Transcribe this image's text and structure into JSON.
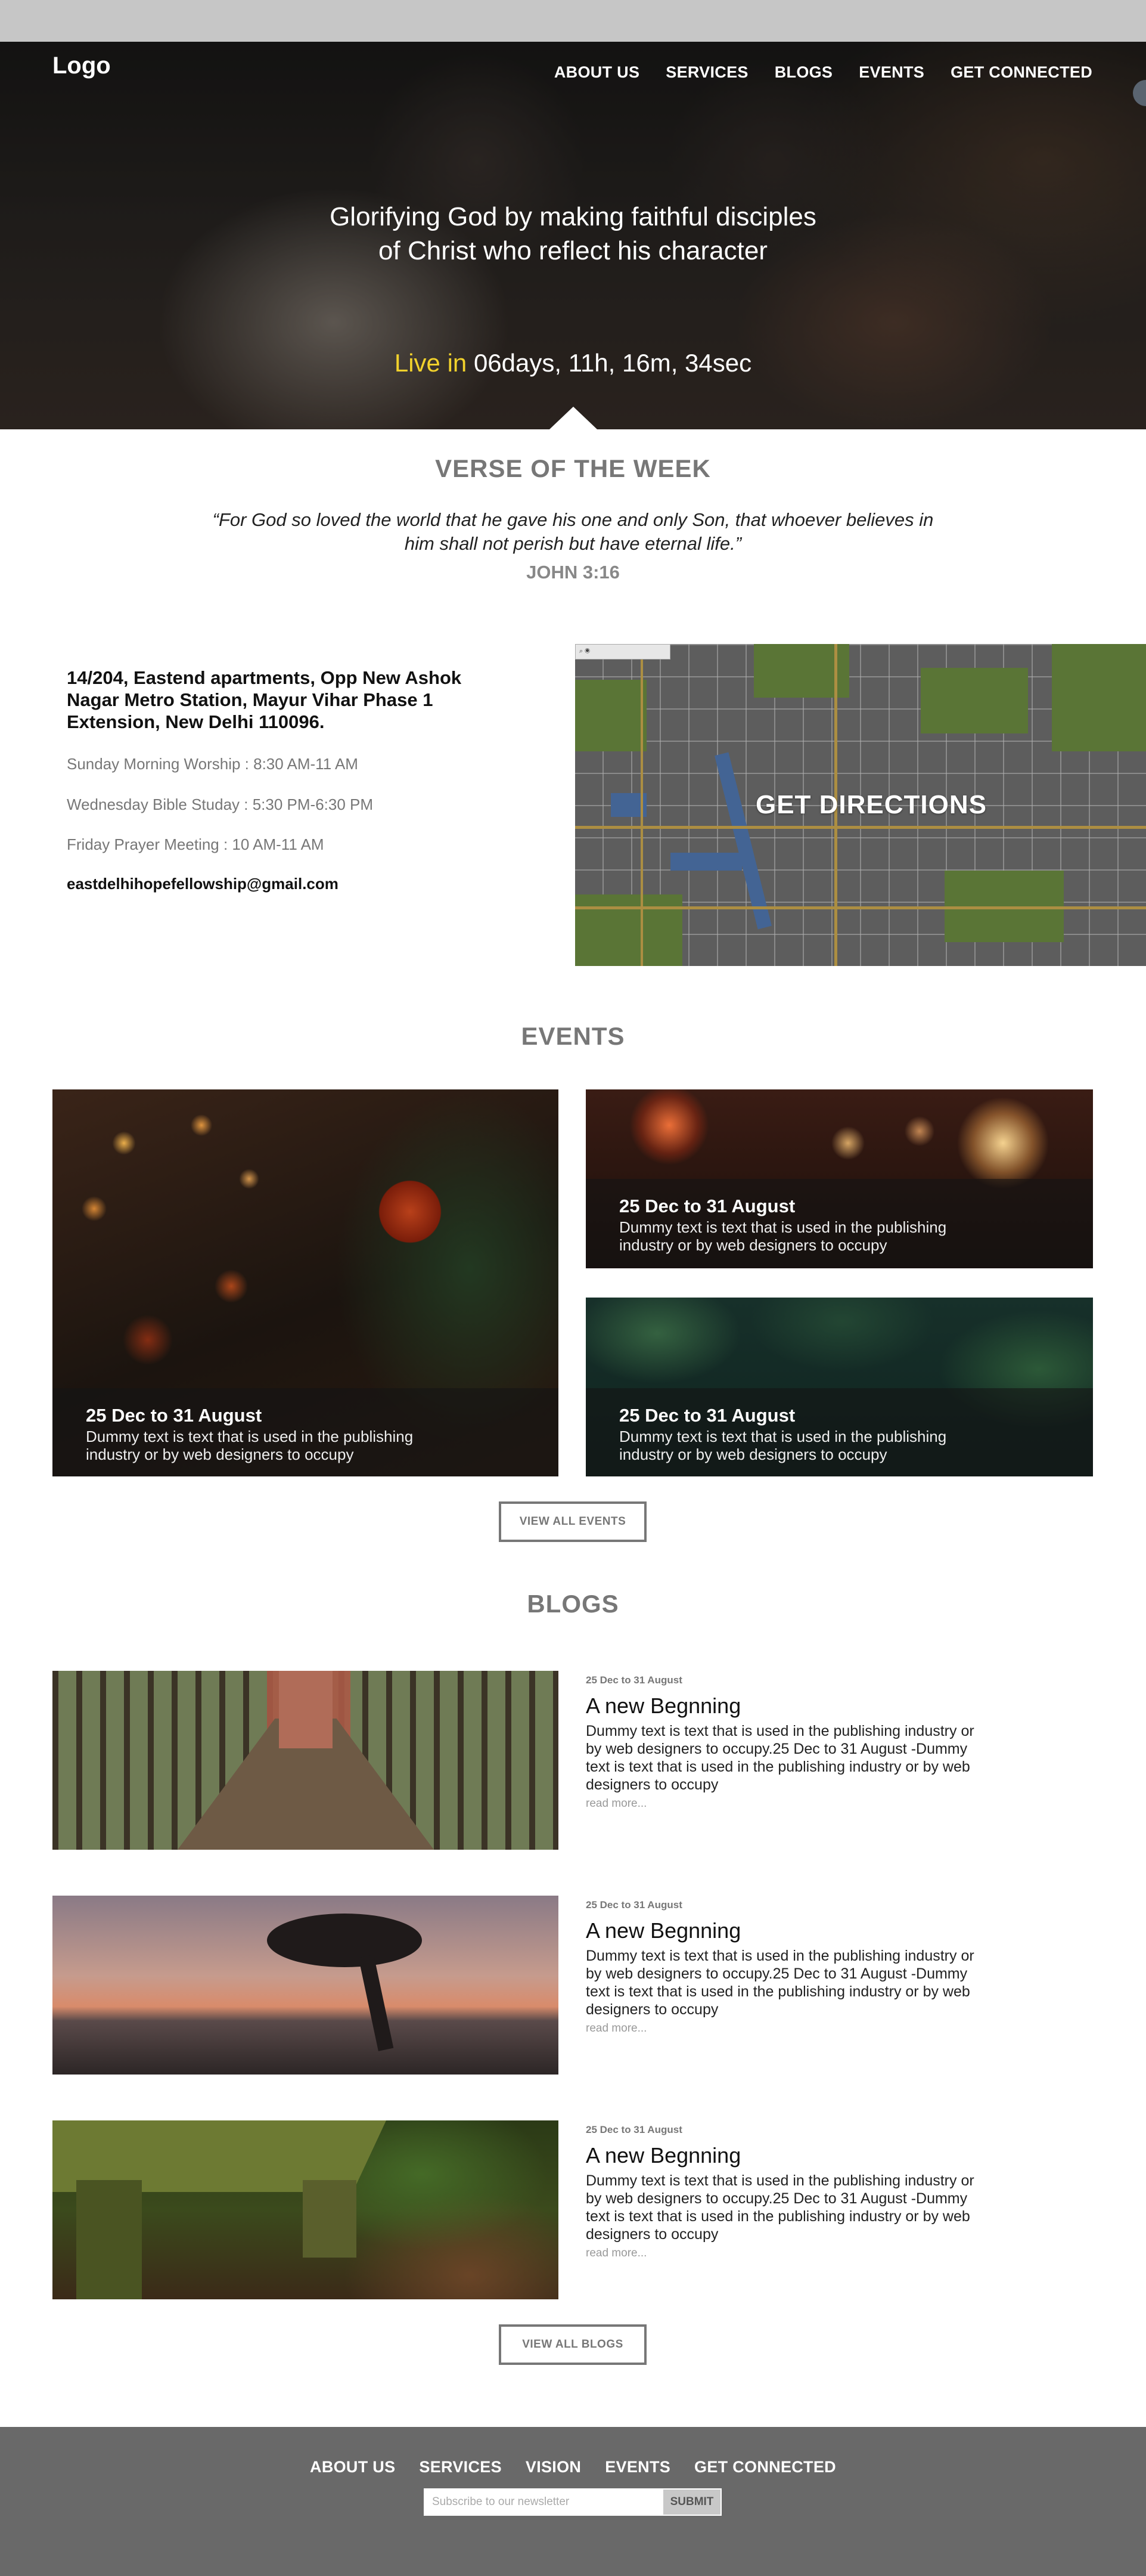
{
  "header": {
    "logo": "Logo",
    "nav": [
      "ABOUT US",
      "SERVICES",
      "BLOGS",
      "EVENTS",
      "GET CONNECTED"
    ]
  },
  "hero": {
    "tagline_line1": "Glorifying God by making faithful disciples",
    "tagline_line2": "of Christ who reflect his character",
    "live_label": "Live in",
    "countdown": "06days, 11h, 16m, 34sec"
  },
  "verse": {
    "heading": "VERSE OF THE WEEK",
    "text": "“For God so loved the world that he gave his one and only Son, that whoever believes in him shall not perish but have eternal life.”",
    "reference": "JOHN 3:16"
  },
  "contact": {
    "address": "14/204, Eastend apartments, Opp New Ashok Nagar Metro Station, Mayur Vihar Phase 1 Extension, New Delhi 110096.",
    "schedule": [
      "Sunday Morning Worship : 8:30 AM-11 AM",
      "Wednesday Bible Studay : 5:30 PM-6:30 PM",
      "Friday Prayer Meeting : 10 AM-11 AM"
    ],
    "email": "eastdelhihopefellowship@gmail.com",
    "map_cta": "GET DIRECTIONS"
  },
  "events": {
    "heading": "EVENTS",
    "items": [
      {
        "date": "25 Dec to 31 August",
        "text": "Dummy text is text that is used in the publishing industry or by web designers to occupy"
      },
      {
        "date": "25 Dec to 31 August",
        "text": "Dummy text is text that is used in the publishing industry or by web designers to occupy"
      },
      {
        "date": "25 Dec to 31 August",
        "text": "Dummy text is text that is used in the publishing industry or by web designers to occupy"
      }
    ],
    "view_all": "VIEW ALL EVENTS"
  },
  "blogs": {
    "heading": "BLOGS",
    "items": [
      {
        "date": "25 Dec to 31 August",
        "title": "A new Begnning",
        "text": "Dummy text is text that is used in the publishing industry or by web designers to occupy.25 Dec to 31 August -Dummy text is text that is used in the publishing industry or by web designers to occupy",
        "read_more": "read more..."
      },
      {
        "date": "25 Dec to 31 August",
        "title": "A new Begnning",
        "text": "Dummy text is text that is used in the publishing industry or by web designers to occupy.25 Dec to 31 August -Dummy text is text that is used in the publishing industry or by web designers to occupy",
        "read_more": "read more..."
      },
      {
        "date": "25 Dec to 31 August",
        "title": "A new Begnning",
        "text": "Dummy text is text that is used in the publishing industry or by web designers to occupy.25 Dec to 31 August -Dummy text is text that is used in the publishing industry or by web designers to occupy",
        "read_more": "read more..."
      }
    ],
    "view_all": "VIEW ALL BLOGS"
  },
  "footer": {
    "nav": [
      "ABOUT US",
      "SERVICES",
      "VISION",
      "EVENTS",
      "GET CONNECTED"
    ],
    "newsletter_placeholder": "Subscribe to our newsletter",
    "submit": "SUBMIT"
  },
  "colors": {
    "accent_yellow": "#f2d22c",
    "heading_gray": "#777777",
    "footer_bg": "#696969"
  }
}
